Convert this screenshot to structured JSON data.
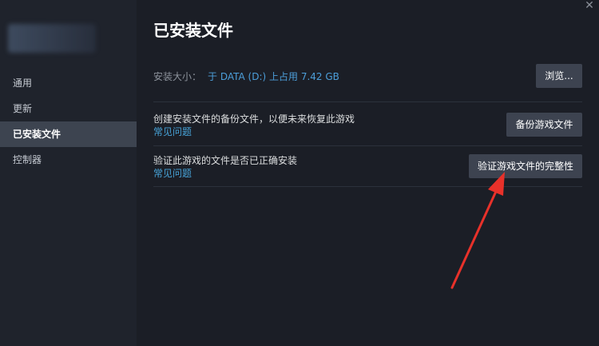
{
  "sidebar": {
    "items": [
      {
        "label": "通用"
      },
      {
        "label": "更新"
      },
      {
        "label": "已安装文件"
      },
      {
        "label": "控制器"
      }
    ]
  },
  "main": {
    "title": "已安装文件",
    "close_glyph": "✕",
    "install_size": {
      "label": "安装大小：",
      "value": "于 DATA (D:) 上占用 7.42 GB",
      "browse_button": "浏览..."
    },
    "backup": {
      "description": "创建安装文件的备份文件，以便未来恢复此游戏",
      "faq_link": "常见问题",
      "button": "备份游戏文件"
    },
    "verify": {
      "description": "验证此游戏的文件是否已正确安装",
      "faq_link": "常见问题",
      "button": "验证游戏文件的完整性"
    }
  },
  "colors": {
    "background": "#1b1e26",
    "sidebar": "#1f232c",
    "active_item": "#3d4450",
    "link": "#47a3d8",
    "button": "#3d4350",
    "annotation_arrow": "#e8312a"
  }
}
